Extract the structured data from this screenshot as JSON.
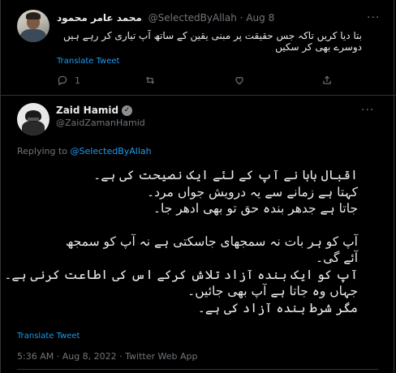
{
  "reply_tweet": {
    "display_name": "محمد عامر محمود",
    "handle": "@SelectedByAllah",
    "separator": "·",
    "date": "Aug 8",
    "text": "بتا دیا کریں تاکہ جس حقیقت پر مبنی یقین کے ساتھ آپ تیاری کر رہے ہیں دوسرے بھی کر سکیں",
    "translate_label": "Translate Tweet",
    "reply_count": "1",
    "more_label": "···"
  },
  "main_tweet": {
    "display_name": "Zaid Hamid",
    "verified_mark": "✓",
    "handle": "@ZaidZamanHamid",
    "more_label": "···",
    "replying_prefix": "Replying to",
    "replying_handle": "@SelectedByAllah",
    "lines": [
      "اقبال بابا نے آپ کے لئے ایک نصیحت کی ہے۔",
      "کہتا ہے زمانے سے یہ درویش جواں مرد۔",
      "جاتا ہے جدھر بندہ حق تو بھی ادھر جا۔",
      "آپ کو ہر بات نہ سمجھای جاسکتی ہے نہ آپ کو سمجھ",
      "آئے گی۔",
      "آپ کو ایک بندہ آزاد تلاش کرکے اس کی اطاعت کرنی ہے۔",
      "جہاں وہ جاتا ہے آپ بھی جائیں۔",
      "مگر شرط بندہ آزاد کی ہے۔"
    ],
    "translate_label": "Translate Tweet",
    "timestamp": "5:36 AM · Aug 8, 2022 · Twitter Web App"
  },
  "colors": {
    "background": "#000000",
    "text": "#e7e9ea",
    "muted": "#71767b",
    "link": "#1d9bf0",
    "divider": "#2f3336"
  },
  "icons": [
    "more-icon",
    "reply-icon",
    "retweet-icon",
    "like-icon",
    "share-icon",
    "verified-badge-icon"
  ]
}
